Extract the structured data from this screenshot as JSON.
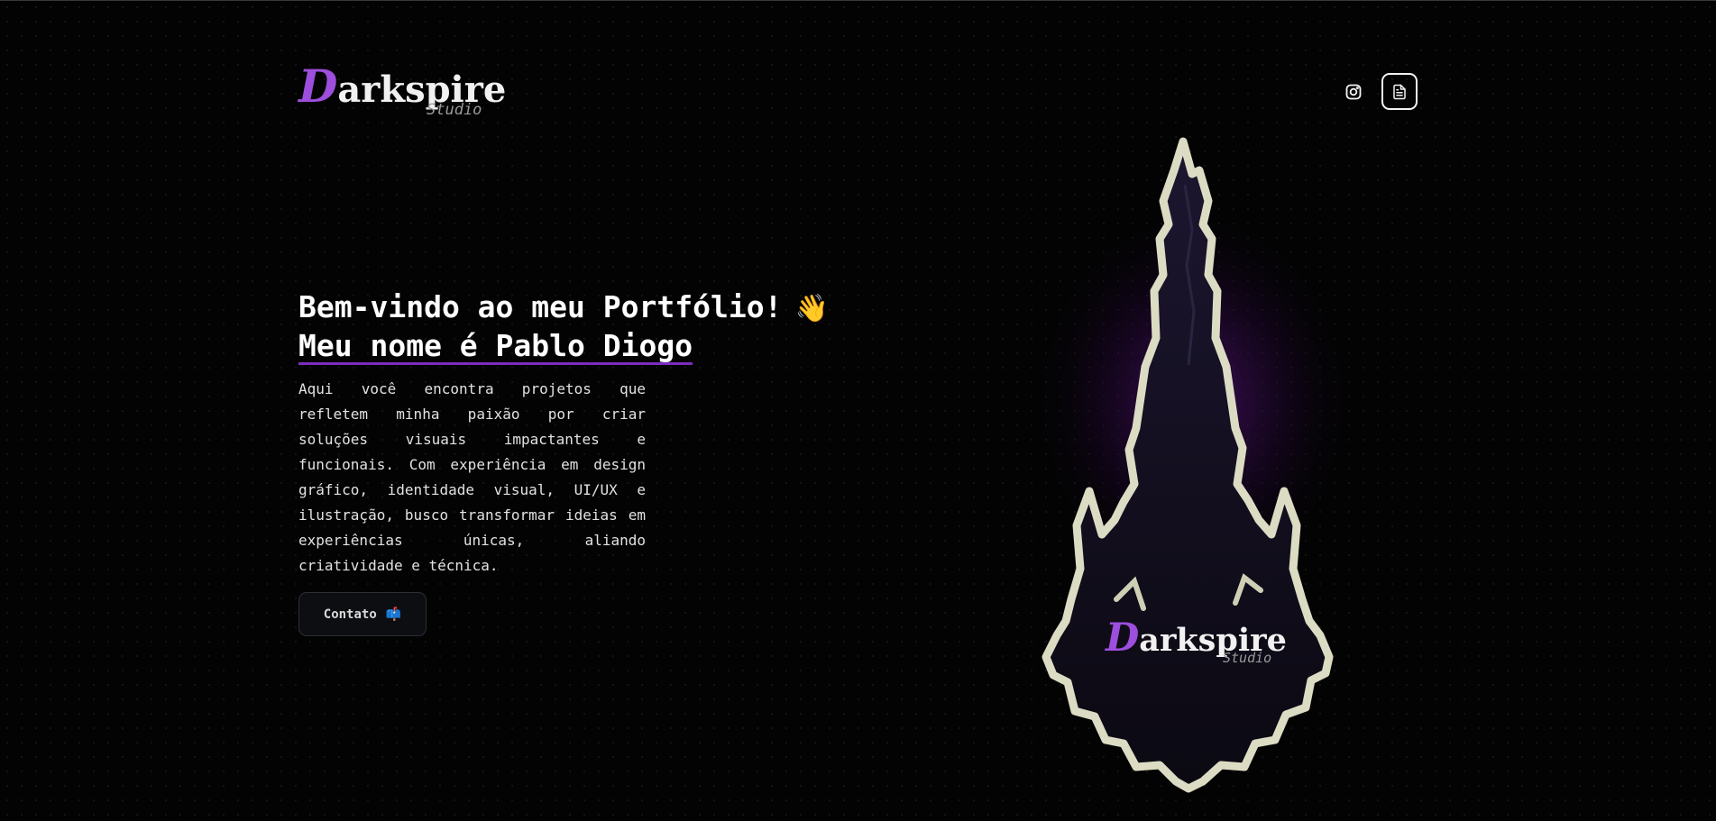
{
  "header": {
    "logo": {
      "initial": "D",
      "rest": "arkspire",
      "sub": "Studio"
    },
    "icons": {
      "instagram": "instagram-icon",
      "document": "document-icon"
    }
  },
  "hero": {
    "title_line1": "Bem-vindo ao meu Portfólio!",
    "wave": "👋",
    "title_line2": "Meu nome é Pablo Diogo",
    "description": "Aqui você encontra projetos que refletem minha paixão por criar soluções visuais impactantes e funcionais. Com experiência em design gráfico, identidade visual, UI/UX e ilustração, busco transformar ideias em experiências únicas, aliando criatividade e técnica.",
    "contact_label": "Contato",
    "contact_icon": "📫"
  },
  "art": {
    "logo": {
      "initial": "D",
      "rest": "arkspire",
      "sub": "Studio"
    }
  },
  "colors": {
    "background": "#030303",
    "accent": "#9d4edd",
    "underline": "#7b2cbf",
    "spire_outline": "#dcdcc4",
    "spire_body": "#14101e"
  }
}
